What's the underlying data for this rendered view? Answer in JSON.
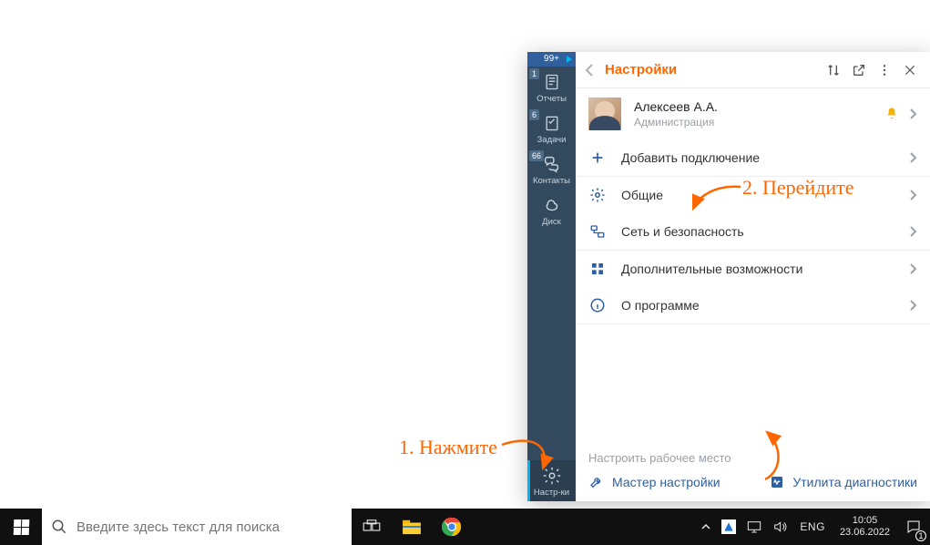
{
  "annotations": {
    "step1": "1. Нажмите",
    "step2": "2. Перейдите"
  },
  "app": {
    "nav": {
      "top_badge": "99+",
      "items": [
        {
          "label": "Отчеты",
          "badge": "1"
        },
        {
          "label": "Задачи",
          "badge": "6"
        },
        {
          "label": "Контакты",
          "badge": "66"
        },
        {
          "label": "Диск",
          "badge": ""
        }
      ],
      "settings_label": "Настр-ки"
    },
    "panel": {
      "title": "Настройки",
      "user": {
        "name": "Алексеев А.А.",
        "dept": "Администрация"
      },
      "add_connection": "Добавить подключение",
      "groups": [
        {
          "label": "Общие"
        },
        {
          "label": "Сеть и безопасность"
        }
      ],
      "groups2": [
        {
          "label": "Дополнительные возможности"
        },
        {
          "label": "О программе"
        }
      ],
      "footer_hint": "Настроить рабочее место",
      "tools": {
        "wizard": "Мастер настройки",
        "diag": "Утилита диагностики"
      }
    }
  },
  "taskbar": {
    "search_placeholder": "Введите здесь текст для поиска",
    "lang": "ENG",
    "time": "10:05",
    "date": "23.06.2022",
    "notif_count": "1"
  }
}
